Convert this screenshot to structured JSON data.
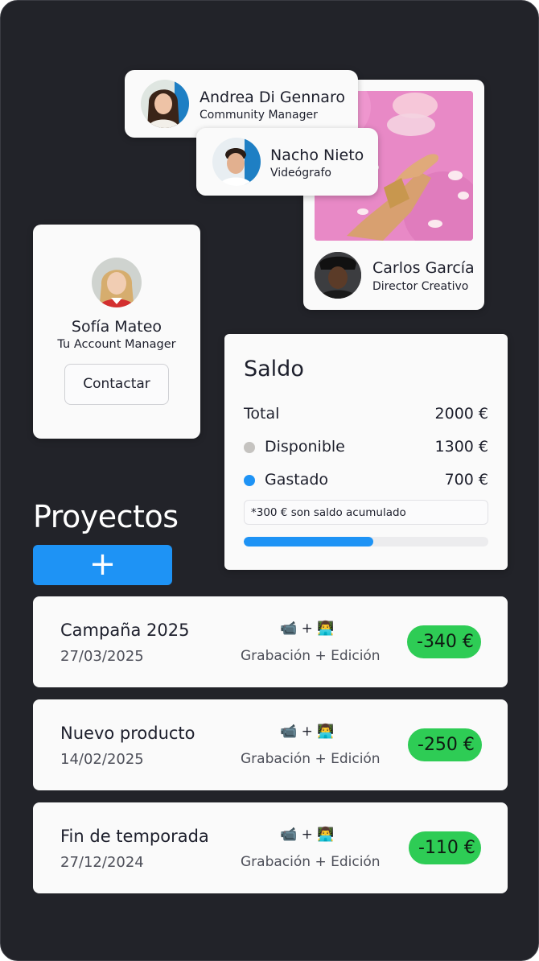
{
  "team": {
    "andrea": {
      "name": "Andrea Di Gennaro",
      "role": "Community Manager"
    },
    "nacho": {
      "name": "Nacho Nieto",
      "role": "Videógrafo"
    },
    "carlos": {
      "name": "Carlos García",
      "role": "Director Creativo"
    }
  },
  "account_manager": {
    "name": "Sofía Mateo",
    "role": "Tu Account Manager",
    "contact_label": "Contactar"
  },
  "saldo": {
    "title": "Saldo",
    "total_label": "Total",
    "total_value": "2000 €",
    "disponible_label": "Disponible",
    "disponible_value": "1300 €",
    "gastado_label": "Gastado",
    "gastado_value": "700 €",
    "note": "*300 € son saldo acumulado",
    "spent_fraction": 0.53,
    "colors": {
      "disponible": "#c5c3c0",
      "gastado": "#1e93f5"
    }
  },
  "projects_heading": "Proyectos",
  "add_button_label": "+",
  "projects": [
    {
      "name": "Campaña 2025",
      "date": "27/03/2025",
      "icons": "📹 + 👨‍💻",
      "services": "Grabación + Edición",
      "amount": "-340 €"
    },
    {
      "name": "Nuevo producto",
      "date": "14/02/2025",
      "icons": "📹 + 👨‍💻",
      "services": "Grabación + Edición",
      "amount": "-250 €"
    },
    {
      "name": "Fin de temporada",
      "date": "27/12/2024",
      "icons": "📹 + 👨‍💻",
      "services": "Grabación + Edición",
      "amount": "-110 €"
    }
  ],
  "colors": {
    "background": "#222329",
    "card": "#fafafa",
    "accent": "#1e93f5",
    "amount_badge": "#2ecc55"
  }
}
